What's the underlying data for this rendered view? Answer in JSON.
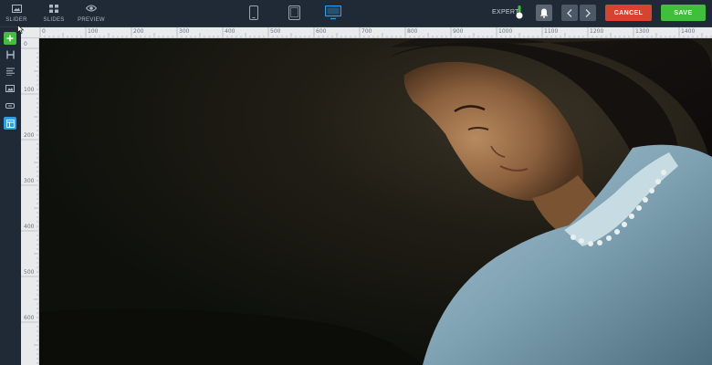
{
  "topbar": {
    "nav": [
      {
        "label": "SLIDER",
        "icon": "image-icon"
      },
      {
        "label": "SLIDES",
        "icon": "grid-icon"
      },
      {
        "label": "PREVIEW",
        "icon": "eye-icon"
      }
    ],
    "devices": [
      "phone-icon",
      "tablet-icon",
      "desktop-icon"
    ],
    "active_device": "desktop",
    "expert_label": "EXPERT",
    "cancel_label": "CANCEL",
    "save_label": "SAVE"
  },
  "lefttools": [
    "add-layer-icon",
    "heading-icon",
    "text-icon",
    "image-icon",
    "button-icon",
    "layout-icon"
  ],
  "rulers": {
    "top": [
      "0",
      "100",
      "200",
      "300",
      "400",
      "500",
      "600",
      "700",
      "800",
      "900",
      "1000",
      "1100",
      "1200",
      "1300",
      "1400"
    ],
    "left": [
      "0",
      "100",
      "200",
      "300",
      "400",
      "500",
      "600"
    ]
  },
  "colors": {
    "cancel": "#d9422e",
    "save": "#3fbf3a",
    "accent": "#2f9de4",
    "add": "#3fbf3a"
  }
}
